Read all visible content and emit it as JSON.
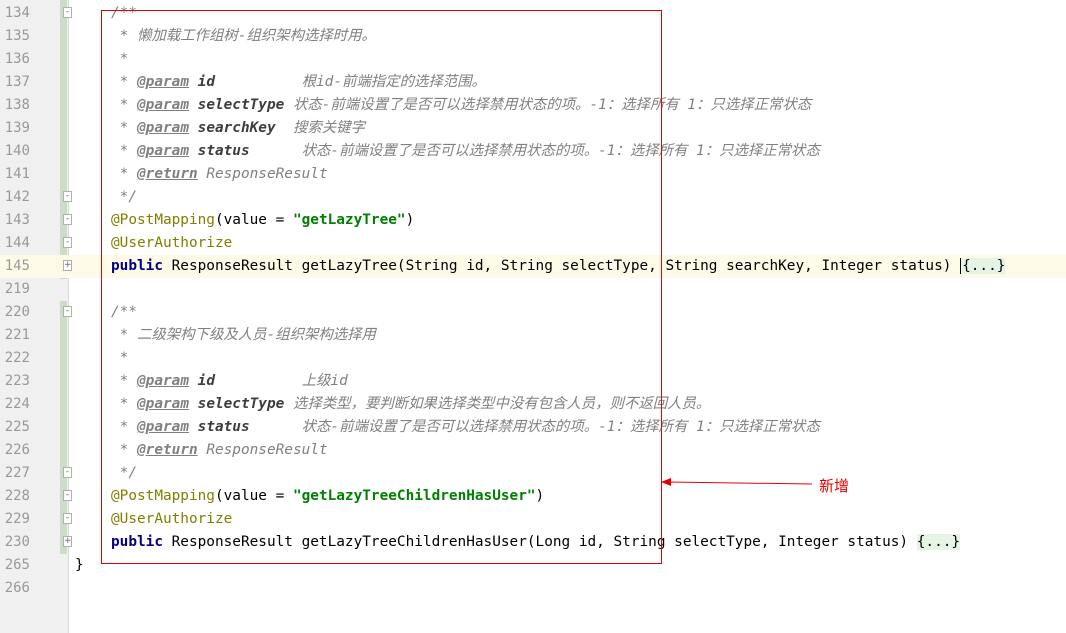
{
  "editor": {
    "lines": [
      {
        "n": "134",
        "fold": "-",
        "parts": [
          {
            "c": "comment",
            "t": "/**"
          }
        ]
      },
      {
        "n": "135",
        "parts": [
          {
            "c": "comment",
            "t": " * 懒加载工作组树-组织架构选择时用。"
          }
        ]
      },
      {
        "n": "136",
        "parts": [
          {
            "c": "comment",
            "t": " *"
          }
        ]
      },
      {
        "n": "137",
        "parts": [
          {
            "c": "comment",
            "t": " * "
          },
          {
            "c": "tag",
            "t": "@param"
          },
          {
            "c": "comment",
            "t": " "
          },
          {
            "c": "pname",
            "t": "id          "
          },
          {
            "c": "comment",
            "t": "根id-前端指定的选择范围。"
          }
        ]
      },
      {
        "n": "138",
        "parts": [
          {
            "c": "comment",
            "t": " * "
          },
          {
            "c": "tag",
            "t": "@param"
          },
          {
            "c": "comment",
            "t": " "
          },
          {
            "c": "pname",
            "t": "selectType "
          },
          {
            "c": "comment",
            "t": "状态-前端设置了是否可以选择禁用状态的项。-1：选择所有 1：只选择正常状态"
          }
        ]
      },
      {
        "n": "139",
        "parts": [
          {
            "c": "comment",
            "t": " * "
          },
          {
            "c": "tag",
            "t": "@param"
          },
          {
            "c": "comment",
            "t": " "
          },
          {
            "c": "pname",
            "t": "searchKey  "
          },
          {
            "c": "comment",
            "t": "搜索关键字"
          }
        ]
      },
      {
        "n": "140",
        "parts": [
          {
            "c": "comment",
            "t": " * "
          },
          {
            "c": "tag",
            "t": "@param"
          },
          {
            "c": "comment",
            "t": " "
          },
          {
            "c": "pname",
            "t": "status      "
          },
          {
            "c": "comment",
            "t": "状态-前端设置了是否可以选择禁用状态的项。-1：选择所有 1：只选择正常状态"
          }
        ]
      },
      {
        "n": "141",
        "parts": [
          {
            "c": "comment",
            "t": " * "
          },
          {
            "c": "tag",
            "t": "@return"
          },
          {
            "c": "comment",
            "t": " ResponseResult"
          }
        ]
      },
      {
        "n": "142",
        "fold": "-",
        "parts": [
          {
            "c": "comment",
            "t": " */"
          }
        ]
      },
      {
        "n": "143",
        "fold": "-",
        "parts": [
          {
            "c": "annot",
            "t": "@PostMapping"
          },
          {
            "c": "",
            "t": "(value = "
          },
          {
            "c": "str",
            "t": "\"getLazyTree\""
          },
          {
            "c": "",
            "t": ")"
          }
        ]
      },
      {
        "n": "144",
        "fold": "-",
        "parts": [
          {
            "c": "annot",
            "t": "@UserAuthorize"
          }
        ]
      },
      {
        "n": "145",
        "fold": "+",
        "current": true,
        "parts": [
          {
            "c": "kw",
            "t": "public"
          },
          {
            "c": "",
            "t": " ResponseResult getLazyTree(String id, String selectType, String searchKey, Integer status) "
          },
          {
            "c": "caret",
            "t": ""
          },
          {
            "c": "folded",
            "t": "{...}"
          }
        ]
      },
      {
        "n": "219",
        "parts": []
      },
      {
        "n": "220",
        "fold": "-",
        "parts": [
          {
            "c": "comment",
            "t": "/**"
          }
        ]
      },
      {
        "n": "221",
        "parts": [
          {
            "c": "comment",
            "t": " * 二级架构下级及人员-组织架构选择用"
          }
        ]
      },
      {
        "n": "222",
        "parts": [
          {
            "c": "comment",
            "t": " *"
          }
        ]
      },
      {
        "n": "223",
        "parts": [
          {
            "c": "comment",
            "t": " * "
          },
          {
            "c": "tag",
            "t": "@param"
          },
          {
            "c": "comment",
            "t": " "
          },
          {
            "c": "pname",
            "t": "id          "
          },
          {
            "c": "comment",
            "t": "上级id"
          }
        ]
      },
      {
        "n": "224",
        "parts": [
          {
            "c": "comment",
            "t": " * "
          },
          {
            "c": "tag",
            "t": "@param"
          },
          {
            "c": "comment",
            "t": " "
          },
          {
            "c": "pname",
            "t": "selectType "
          },
          {
            "c": "comment",
            "t": "选择类型，要判断如果选择类型中没有包含人员，则不返回人员。"
          }
        ]
      },
      {
        "n": "225",
        "parts": [
          {
            "c": "comment",
            "t": " * "
          },
          {
            "c": "tag",
            "t": "@param"
          },
          {
            "c": "comment",
            "t": " "
          },
          {
            "c": "pname",
            "t": "status      "
          },
          {
            "c": "comment",
            "t": "状态-前端设置了是否可以选择禁用状态的项。-1：选择所有 1：只选择正常状态"
          }
        ]
      },
      {
        "n": "226",
        "parts": [
          {
            "c": "comment",
            "t": " * "
          },
          {
            "c": "tag",
            "t": "@return"
          },
          {
            "c": "comment",
            "t": " ResponseResult"
          }
        ]
      },
      {
        "n": "227",
        "fold": "-",
        "parts": [
          {
            "c": "comment",
            "t": " */"
          }
        ]
      },
      {
        "n": "228",
        "fold": "-",
        "parts": [
          {
            "c": "annot",
            "t": "@PostMapping"
          },
          {
            "c": "",
            "t": "(value = "
          },
          {
            "c": "str",
            "t": "\"getLazyTreeChildrenHasUser\""
          },
          {
            "c": "",
            "t": ")"
          }
        ]
      },
      {
        "n": "229",
        "fold": "-",
        "parts": [
          {
            "c": "annot",
            "t": "@UserAuthorize"
          }
        ]
      },
      {
        "n": "230",
        "fold": "+",
        "parts": [
          {
            "c": "kw",
            "t": "public"
          },
          {
            "c": "",
            "t": " ResponseResult getLazyTreeChildrenHasUser(Long id, String selectType, Integer status) "
          },
          {
            "c": "folded",
            "t": "{...}"
          }
        ]
      },
      {
        "n": "265",
        "outdent": true,
        "parts": [
          {
            "c": "",
            "t": "}"
          }
        ]
      },
      {
        "n": "266",
        "parts": []
      }
    ]
  },
  "annotation": {
    "label": "新增",
    "color": "#e60000"
  }
}
